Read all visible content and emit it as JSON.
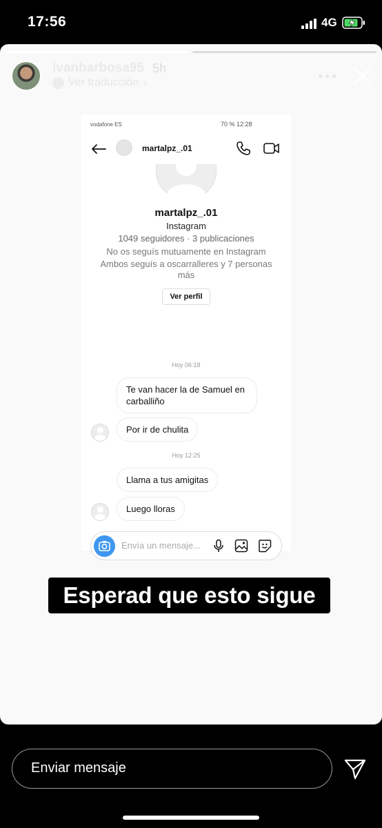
{
  "status_bar": {
    "time": "17:56",
    "network": "4G"
  },
  "story": {
    "username": "ivanbarbosa95",
    "time_ago": "5h",
    "translate_label": "Ver traducción",
    "caption": "Esperad que esto sigue"
  },
  "screenshot": {
    "status_carrier": "vodafone ES",
    "status_right": "70 %  12:28",
    "handle": "martalpz_.01",
    "profile": {
      "name": "martalpz_.01",
      "subtitle": "Instagram",
      "stats": "1049 seguidores · 3 publicaciones",
      "mutual": "No os seguís mutuamente en Instagram",
      "followed_by": "Ambos seguís a oscarralleres y 7 personas más",
      "view_profile": "Ver perfil"
    },
    "timestamp_1": "Hoy 06:18",
    "messages_1": [
      "Te van hacer la de Samuel en carballiño",
      "Por ir de chulita"
    ],
    "timestamp_2": "Hoy 12:25",
    "messages_2": [
      "Llama a tus amigitas",
      "Luego lloras"
    ],
    "composer_placeholder": "Envía un mensaje..."
  },
  "reply": {
    "placeholder": "Enviar mensaje"
  },
  "colors": {
    "camera_blue": "#3f97f0",
    "story_bg": "#f9f9f9"
  }
}
